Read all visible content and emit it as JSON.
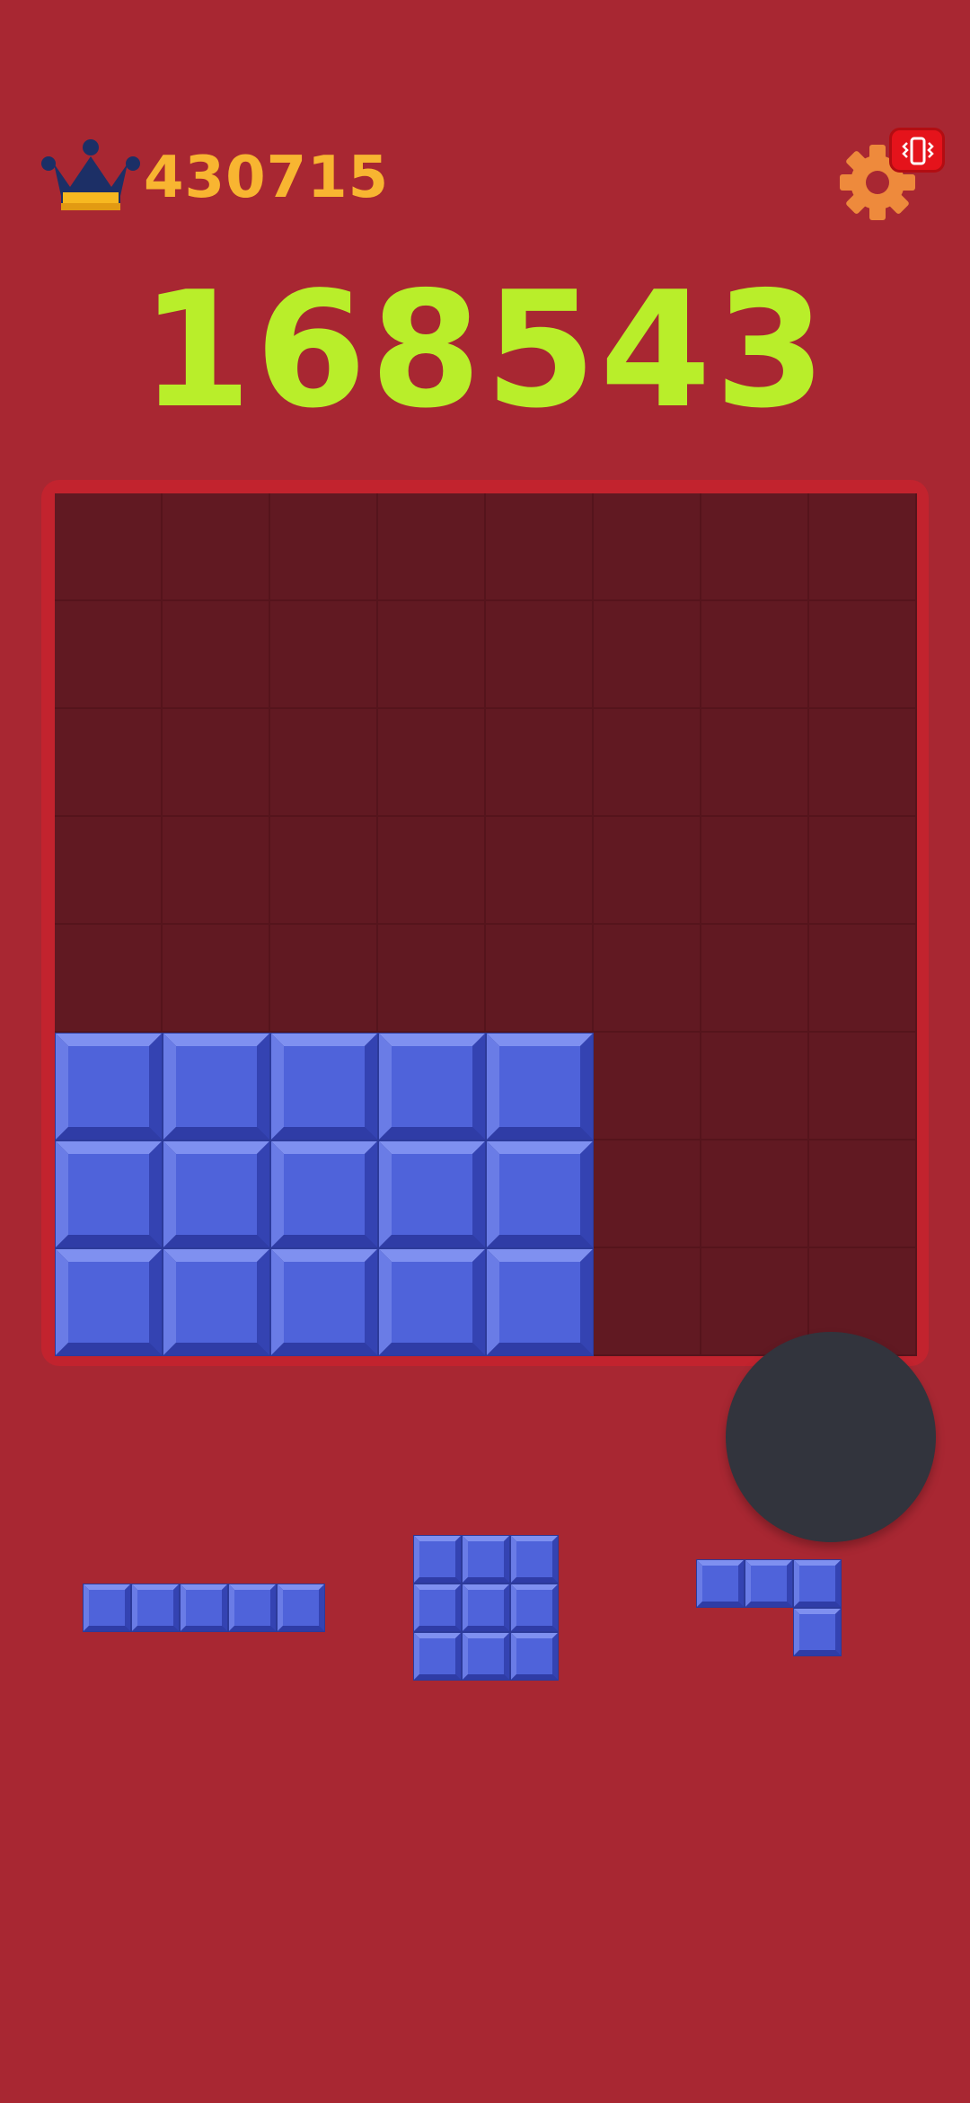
{
  "header": {
    "best_score": "430715",
    "crown_icon": "crown-icon",
    "settings_icon": "gear-icon",
    "vibration_icon": "vibration-icon"
  },
  "score": "168543",
  "board": {
    "size": 8,
    "filled": [
      [
        0,
        0,
        0,
        0,
        0,
        0,
        0,
        0
      ],
      [
        0,
        0,
        0,
        0,
        0,
        0,
        0,
        0
      ],
      [
        0,
        0,
        0,
        0,
        0,
        0,
        0,
        0
      ],
      [
        0,
        0,
        0,
        0,
        0,
        0,
        0,
        0
      ],
      [
        0,
        0,
        0,
        0,
        0,
        0,
        0,
        0
      ],
      [
        1,
        1,
        1,
        1,
        1,
        0,
        0,
        0
      ],
      [
        1,
        1,
        1,
        1,
        1,
        0,
        0,
        0
      ],
      [
        1,
        1,
        1,
        1,
        1,
        0,
        0,
        0
      ]
    ]
  },
  "pieces": [
    {
      "name": "piece-line-5",
      "shape": [
        [
          1,
          1,
          1,
          1,
          1
        ]
      ]
    },
    {
      "name": "piece-square-3x3",
      "shape": [
        [
          1,
          1,
          1
        ],
        [
          1,
          1,
          1
        ],
        [
          1,
          1,
          1
        ]
      ]
    },
    {
      "name": "piece-corner",
      "shape": [
        [
          1,
          1,
          1
        ],
        [
          0,
          0,
          1
        ]
      ]
    }
  ],
  "colors": {
    "background": "#a82732",
    "board": "#611922",
    "block": "#4f63da",
    "score": "#b9ee2a",
    "best_score": "#f8b531",
    "gear": "#ee8a3c",
    "badge": "#e5131b",
    "fab": "#32343d"
  }
}
